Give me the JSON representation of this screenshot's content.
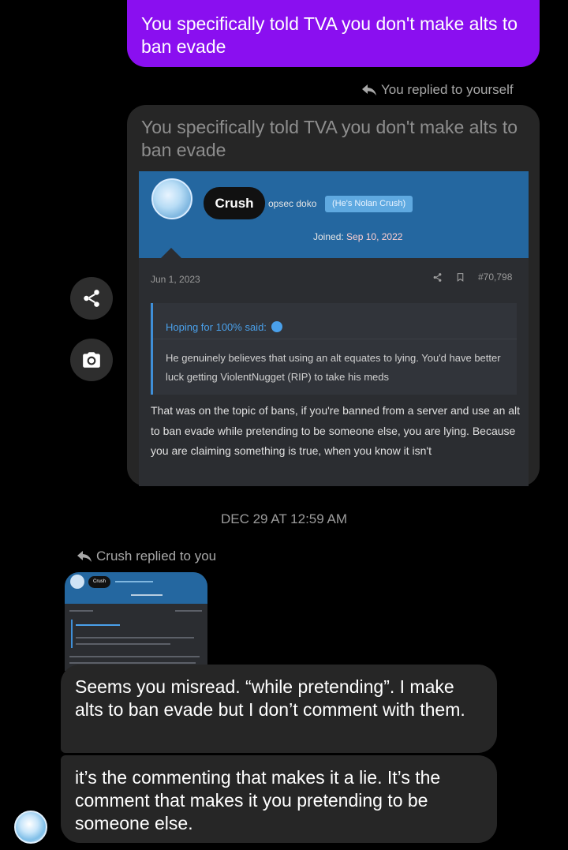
{
  "sent": {
    "text": "You specifically told TVA you don't make alts to ban evade",
    "color": "#8a0ff0"
  },
  "reply_self": {
    "icon": "reply-arrow-icon",
    "label": "You replied to yourself"
  },
  "quoted_message": {
    "text": "You specifically told TVA you don't make alts to ban evade",
    "forum_post": {
      "username": "Crush",
      "subtitle": "opsec doko",
      "badge": "(He's Nolan Crush)",
      "joined_label": "Joined:",
      "joined_date": "Sep 10, 2022",
      "post_date": "Jun 1, 2023",
      "post_number": "#70,798",
      "quote_author": "Hoping for 100% said:",
      "quote_text": "He genuinely believes that using an alt equates to lying. You'd have better luck getting ViolentNugget (RIP) to take his meds",
      "body": "That was on the topic of bans, if you're banned from a server and use an alt to ban evade while pretending to be someone else, you are lying. Because you are claiming something is true, when you know it isn't"
    }
  },
  "side_buttons": {
    "share_icon": "share-icon",
    "camera_icon": "camera-icon"
  },
  "timestamp": "DEC 29 AT 12:59 AM",
  "reply_other": {
    "icon": "reply-arrow-icon",
    "label": "Crush replied to you"
  },
  "received": [
    {
      "text": "Seems you misread. “while pretending”. I make alts to ban evade but I don’t comment with them."
    },
    {
      "text": "it’s the commenting that makes it a lie. It’s the comment that makes it you pretending to be someone else."
    }
  ]
}
